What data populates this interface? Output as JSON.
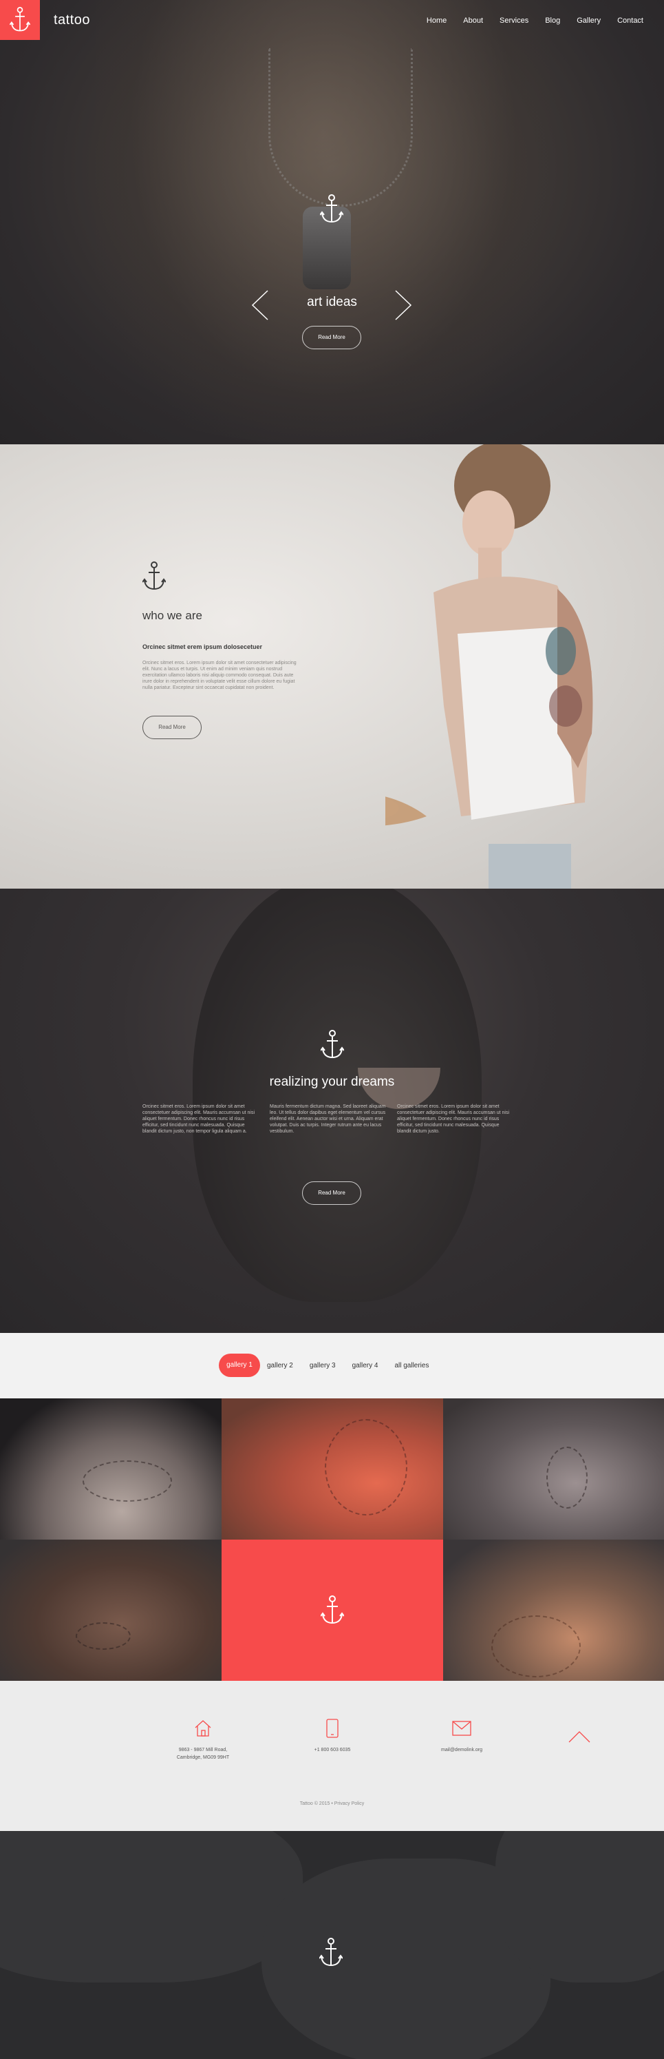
{
  "header": {
    "brand": "tattoo",
    "logo_icon": "anchor-icon",
    "accent": "#f74b4b",
    "nav": [
      {
        "label": "Home"
      },
      {
        "label": "About"
      },
      {
        "label": "Services"
      },
      {
        "label": "Blog"
      },
      {
        "label": "Gallery"
      },
      {
        "label": "Contact"
      }
    ]
  },
  "hero": {
    "title": "art ideas",
    "button": "Read More",
    "prev_icon": "chevron-left-icon",
    "next_icon": "chevron-right-icon"
  },
  "about": {
    "title": "who we are",
    "subtitle": "Orcinec sitmet erem ipsum dolosecetuer",
    "text": "Orcinec sitmet eros. Lorem ipsum dolor sit amet consectetuer adipiscing elit. Nunc a lacus et turpis. Ut enim ad minim veniam quis nostrud exercitation ullamco laboris nisi aliquip commodo consequat. Duis aute irure dolor in reprehenderit in voluptate velit esse cillum dolore eu fugiat nulla pariatur. Excepteur sint occaecat cupidatat non proident.",
    "button": "Read More"
  },
  "dreams": {
    "title": "realizing your dreams",
    "columns": [
      "Orcinec sitmet eros. Lorem ipsum dolor sit amet consectetuer adipiscing elit. Mauris accumsan ut nisi aliquet fermentum. Donec rhoncus nunc id risus efficitur, sed tincidunt nunc malesuada. Quisque blandit dictum justo, non tempor ligula aliquam a.",
      "Mauris fermentum dictum magna. Sed laoreet aliquam leo. Ut tellus dolor dapibus eget elementum vel cursus eleifend elit. Aenean auctor wisi et urna. Aliquam erat volutpat. Duis ac turpis. Integer rutrum ante eu lacus vestibulum.",
      "Orcinec sitmet eros. Lorem ipsum dolor sit amet consectetuer adipiscing elit. Mauris accumsan ut nisi aliquet fermentum. Donec rhoncus nunc id risus efficitur, sed tincidunt nunc malesuada. Quisque blandit dictum justo."
    ],
    "button": "Read More"
  },
  "gallery": {
    "tabs": [
      {
        "label": "gallery 1",
        "active": true
      },
      {
        "label": "gallery 2"
      },
      {
        "label": "gallery 3"
      },
      {
        "label": "gallery 4"
      },
      {
        "label": "all galleries"
      }
    ]
  },
  "contacts": {
    "address_line1": "9863 - 9867 Mill Road,",
    "address_line2": "Cambridge, MG09 99HT",
    "phone": "+1 800 603 6035",
    "email": "mail@demolink.org",
    "copyright": "Tattoo © 2015 • Privacy Policy"
  }
}
